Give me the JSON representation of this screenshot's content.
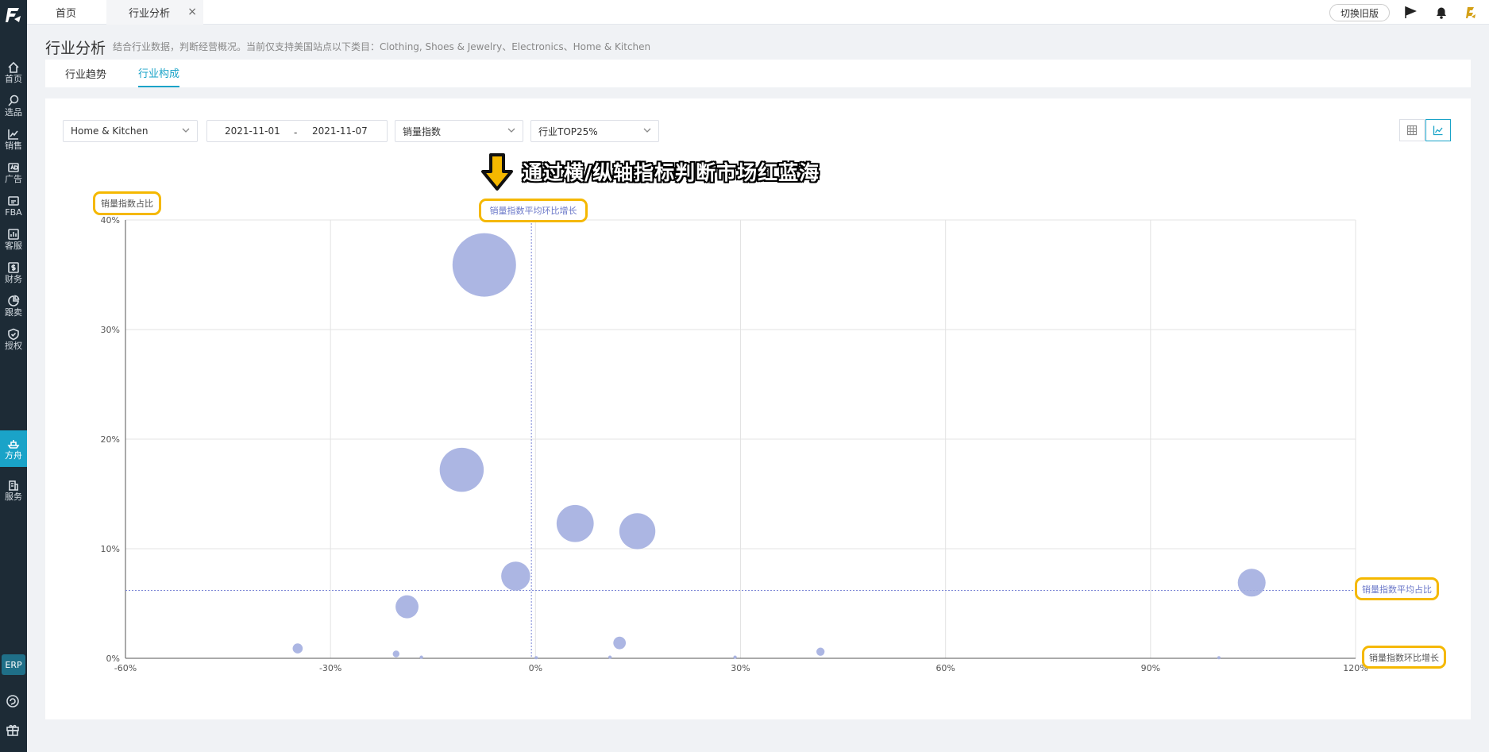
{
  "sidebar": {
    "items": [
      {
        "label": "首页",
        "icon": "home-icon"
      },
      {
        "label": "选品",
        "icon": "search-icon"
      },
      {
        "label": "销售",
        "icon": "trend-icon"
      },
      {
        "label": "广告",
        "icon": "ad-icon"
      },
      {
        "label": "FBA",
        "icon": "fba-icon"
      },
      {
        "label": "客服",
        "icon": "chart-box-icon"
      },
      {
        "label": "财务",
        "icon": "dollar-icon"
      },
      {
        "label": "跟卖",
        "icon": "pie-icon"
      },
      {
        "label": "授权",
        "icon": "shield-icon"
      },
      {
        "label": "方舟",
        "icon": "ark-icon"
      },
      {
        "label": "服务",
        "icon": "building-icon"
      }
    ],
    "active_index": 9,
    "erp_label": "ERP"
  },
  "topbar": {
    "tabs": [
      {
        "label": "首页"
      },
      {
        "label": "行业分析"
      }
    ],
    "close_glyph": "×",
    "old_version_label": "切换旧版"
  },
  "page": {
    "title": "行业分析",
    "description": "结合行业数据，判断经营概况。当前仅支持美国站点以下类目：Clothing, Shoes & Jewelry、Electronics、Home & Kitchen"
  },
  "subtabs": [
    {
      "label": "行业趋势",
      "active": false
    },
    {
      "label": "行业构成",
      "active": true
    }
  ],
  "filters": {
    "category": "Home & Kitchen",
    "date_start": "2021-11-01",
    "date_sep": "-",
    "date_end": "2021-11-07",
    "metric": "销量指数",
    "range": "行业TOP25%"
  },
  "annotation": {
    "text": "通过横/纵轴指标判断市场红蓝海",
    "avg_growth_label": "销量指数平均环比增长",
    "avg_share_label": "销量指数平均占比",
    "y_axis_label": "销量指数占比",
    "x_axis_label": "销量指数环比增长"
  },
  "chart_data": {
    "type": "scatter",
    "xlabel": "销量指数环比增长",
    "ylabel": "销量指数占比",
    "xlim": [
      -60,
      120
    ],
    "ylim": [
      0,
      40
    ],
    "x_ticks": [
      -60,
      -30,
      0,
      30,
      60,
      90,
      120
    ],
    "y_ticks": [
      0,
      10,
      20,
      30,
      40
    ],
    "x_tick_labels": [
      "-60%",
      "-30%",
      "0%",
      "30%",
      "60%",
      "90%",
      "120%"
    ],
    "y_tick_labels": [
      "0%",
      "10%",
      "20%",
      "30%",
      "40%"
    ],
    "avg_x": -0.6,
    "avg_y": 6.2,
    "grid": true,
    "point_color": "#a3aee0",
    "avg_line_color": "#7b86d6",
    "points": [
      {
        "x": -7.5,
        "y": 35.9,
        "size": 36.0
      },
      {
        "x": -10.8,
        "y": 17.2,
        "size": 17.3
      },
      {
        "x": 5.8,
        "y": 12.3,
        "size": 12.3
      },
      {
        "x": 14.9,
        "y": 11.6,
        "size": 11.6
      },
      {
        "x": -2.9,
        "y": 7.5,
        "size": 7.5
      },
      {
        "x": 104.8,
        "y": 6.9,
        "size": 6.9
      },
      {
        "x": -18.8,
        "y": 4.7,
        "size": 4.7
      },
      {
        "x": -34.8,
        "y": 0.9,
        "size": 0.9
      },
      {
        "x": -20.4,
        "y": 0.4,
        "size": 0.4
      },
      {
        "x": -16.7,
        "y": 0.1,
        "size": 0.1
      },
      {
        "x": 0.1,
        "y": 0.05,
        "size": 0.05
      },
      {
        "x": 10.9,
        "y": 0.1,
        "size": 0.1
      },
      {
        "x": 12.3,
        "y": 1.4,
        "size": 1.4
      },
      {
        "x": 29.2,
        "y": 0.1,
        "size": 0.1
      },
      {
        "x": 41.7,
        "y": 0.6,
        "size": 0.6
      },
      {
        "x": 100.0,
        "y": 0.05,
        "size": 0.05
      }
    ]
  }
}
